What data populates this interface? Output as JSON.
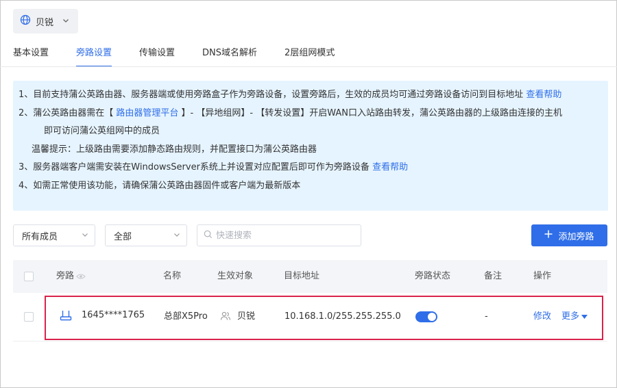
{
  "network_selector": {
    "label": "贝锐",
    "icon": "globe-icon"
  },
  "tabs": [
    {
      "label": "基本设置",
      "active": false
    },
    {
      "label": "旁路设置",
      "active": true
    },
    {
      "label": "传输设置",
      "active": false
    },
    {
      "label": "DNS域名解析",
      "active": false
    },
    {
      "label": "2层组网模式",
      "active": false
    }
  ],
  "notice": {
    "line1": "1、目前支持蒲公英路由器、服务器端或使用旁路盒子作为旁路设备，设置旁路后，生效的成员均可通过旁路设备访问到目标地址 ",
    "line1_link": "查看帮助",
    "line2_a": "2、蒲公英路由器需在【 ",
    "line2_link": "路由器管理平台",
    "line2_b": " 】- 【异地组网】- 【转发设置】开启WAN口入站路由转发，蒲公英路由器的上级路由连接的主机",
    "line2_cont": "即可访问蒲公英组网中的成员",
    "tip": "温馨提示：上级路由需要添加静态路由规则，并配置接口为蒲公英路由器",
    "line3": "3、服务器端客户端需安装在WindowsServer系统上并设置对应配置后即可作为旁路设备 ",
    "line3_link": "查看帮助",
    "line4": "4、如需正常使用该功能，请确保蒲公英路由器固件或客户端为最新版本"
  },
  "filters": {
    "member_select": "所有成员",
    "type_select": "全部",
    "search_placeholder": "快速搜索",
    "add_button": "添加旁路"
  },
  "table": {
    "headers": {
      "bypass": "旁路",
      "name": "名称",
      "target": "生效对象",
      "address": "目标地址",
      "status": "旁路状态",
      "remark": "备注",
      "action": "操作"
    },
    "rows": [
      {
        "device_id": "1645****1765",
        "name": "总部X5Pro",
        "target": "贝锐",
        "address": "10.168.1.0/255.255.255.0",
        "status_on": true,
        "remark": "-",
        "edit": "修改",
        "more": "更多"
      }
    ]
  },
  "colors": {
    "accent": "#2f6ee8",
    "notice_bg": "#e6f4ff",
    "highlight": "#d9224a"
  }
}
